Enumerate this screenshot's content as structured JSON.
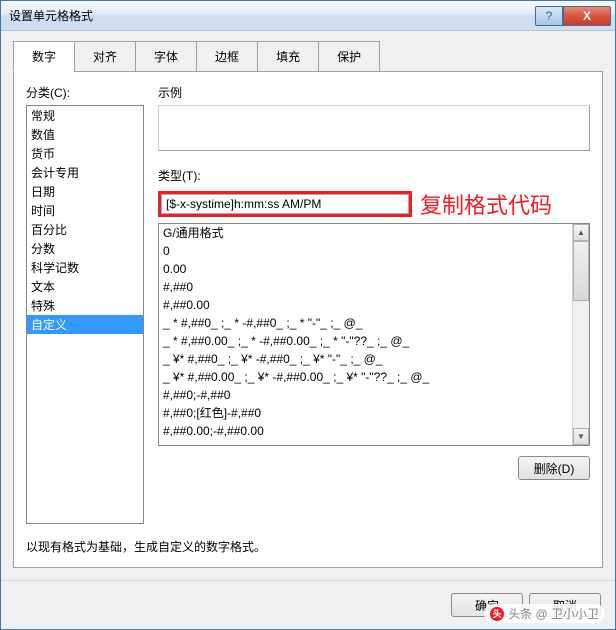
{
  "window": {
    "title": "设置单元格格式",
    "help": "?",
    "close": "X"
  },
  "tabs": [
    "数字",
    "对齐",
    "字体",
    "边框",
    "填充",
    "保护"
  ],
  "activeTab": 0,
  "categoryLabel": "分类(C):",
  "categories": [
    "常规",
    "数值",
    "货币",
    "会计专用",
    "日期",
    "时间",
    "百分比",
    "分数",
    "科学记数",
    "文本",
    "特殊",
    "自定义"
  ],
  "selectedCategory": 11,
  "exampleLabel": "示例",
  "typeLabel": "类型(T):",
  "typeValue": "[$-x-systime]h:mm:ss AM/PM",
  "annotation": "复制格式代码",
  "typeList": [
    "G/通用格式",
    "0",
    "0.00",
    "#,##0",
    "#,##0.00",
    "_ * #,##0_ ;_ * -#,##0_ ;_ * \"-\"_ ;_ @_ ",
    "_ * #,##0.00_ ;_ * -#,##0.00_ ;_ * \"-\"??_ ;_ @_ ",
    "_ ¥* #,##0_ ;_ ¥* -#,##0_ ;_ ¥* \"-\"_ ;_ @_ ",
    "_ ¥* #,##0.00_ ;_ ¥* -#,##0.00_ ;_ ¥* \"-\"??_ ;_ @_ ",
    "#,##0;-#,##0",
    "#,##0;[红色]-#,##0",
    "#,##0.00;-#,##0.00"
  ],
  "deleteBtn": "删除(D)",
  "description": "以现有格式为基础，生成自定义的数字格式。",
  "footer": {
    "ok": "确定",
    "cancel": "取消"
  },
  "watermark": "头条 @ 卫小小卫"
}
